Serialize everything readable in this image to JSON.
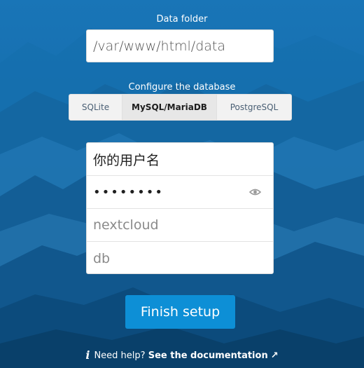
{
  "colors": {
    "background": "#0f5c9c",
    "primary_button": "#0d8fd6",
    "selected_tab": "#e7e7e7"
  },
  "data_folder": {
    "label": "Data folder",
    "value": "/var/www/html/data"
  },
  "database": {
    "label": "Configure the database",
    "tabs": [
      {
        "label": "SQLite",
        "selected": false
      },
      {
        "label": "MySQL/MariaDB",
        "selected": true
      },
      {
        "label": "PostgreSQL",
        "selected": false
      }
    ],
    "fields": {
      "user": "你的用户名",
      "password": "••••••••",
      "name_placeholder": "nextcloud",
      "host_placeholder": "db"
    },
    "password_toggle_icon": "eye-icon"
  },
  "finish_button": {
    "label": "Finish setup"
  },
  "help": {
    "icon": "info-icon",
    "text": "Need help?",
    "link": "See the documentation",
    "link_icon": "external-arrow-icon",
    "arrow_glyph": "↗"
  }
}
